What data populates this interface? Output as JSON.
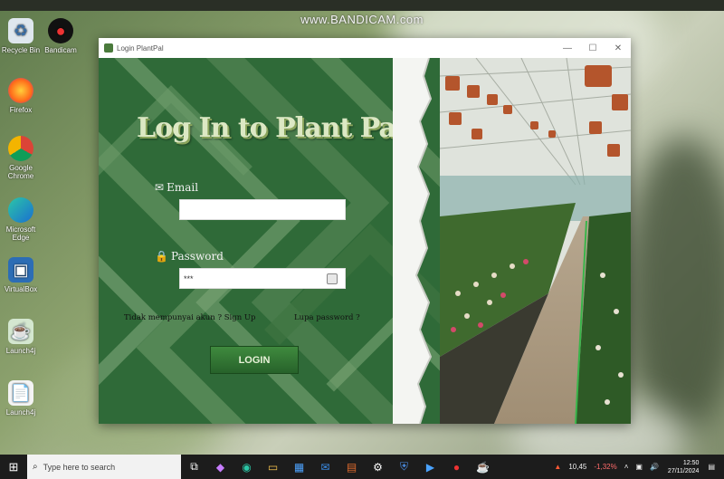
{
  "watermark": "www.BANDICAM.com",
  "desktop": {
    "icons": [
      {
        "label": "Recycle Bin",
        "icon": "recycle-bin-icon"
      },
      {
        "label": "Bandicam",
        "icon": "bandicam-icon"
      },
      {
        "label": "Firefox",
        "icon": "firefox-icon"
      },
      {
        "label": "Google Chrome",
        "icon": "chrome-icon"
      },
      {
        "label": "Microsoft Edge",
        "icon": "edge-icon"
      },
      {
        "label": "VirtualBox",
        "icon": "virtualbox-icon"
      },
      {
        "label": "Launch4j",
        "icon": "launch4j-icon"
      },
      {
        "label": "Launch4j",
        "icon": "launch4j-icon"
      }
    ]
  },
  "window": {
    "title": "Login PlantPal",
    "controls": {
      "minimize": "—",
      "maximize": "☐",
      "close": "✕"
    }
  },
  "login": {
    "heading": "Log In to Plant Pal",
    "email_label": "Email",
    "email_value": "",
    "password_label": "Password",
    "password_value": "***",
    "signup_prompt": "Tidak mempunyai akun ?",
    "signup_link": "Sign Up",
    "forgot_link": "Lupa password ?",
    "login_button": "LOGIN"
  },
  "taskbar": {
    "search_placeholder": "Type here to search",
    "tray": {
      "value": "10,45",
      "change": "-1,32%",
      "time": "12:50",
      "date": "27/11/2024"
    }
  },
  "colors": {
    "login_green": "#2f6a38",
    "heading_text": "#dce8c4",
    "button_green": "#3f8a3e",
    "taskbar": "#1c1c1c",
    "change_red": "#ff6b6b"
  }
}
